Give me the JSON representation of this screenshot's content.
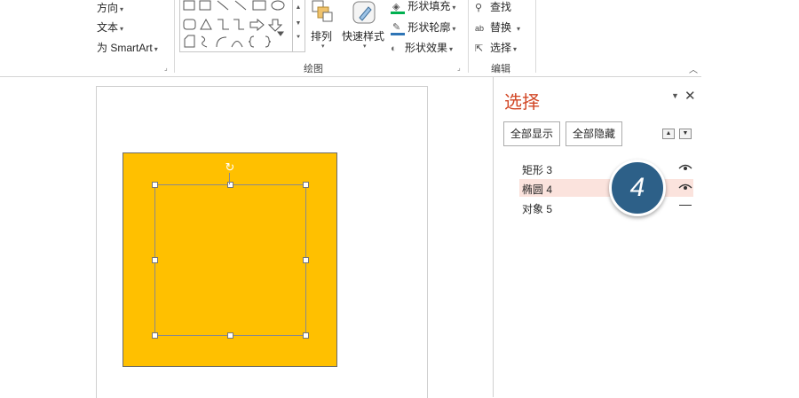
{
  "ribbon": {
    "text_group": {
      "direction_label": "方向",
      "text_label": "文本",
      "smartart_label": "为 SmartArt"
    },
    "drawing_group": {
      "label": "绘图",
      "arrange_label": "排列",
      "quick_styles_label": "快速样式",
      "shape_fill_label": "形状填充",
      "shape_outline_label": "形状轮廓",
      "shape_effects_label": "形状效果"
    },
    "editing_group": {
      "label": "编辑",
      "find_label": "查找",
      "replace_label": "替换",
      "select_label": "选择"
    },
    "colors": {
      "fill_swatch": "#00b050",
      "outline_swatch": "#2e75b6"
    }
  },
  "canvas": {
    "rect_fill": "#ffc000"
  },
  "selection_pane": {
    "title": "选择",
    "show_all_label": "全部显示",
    "hide_all_label": "全部隐藏",
    "items": [
      {
        "label": "矩形 3",
        "visible": true,
        "selected": false
      },
      {
        "label": "椭圆 4",
        "visible": true,
        "selected": true
      },
      {
        "label": "对象 5",
        "visible": false,
        "selected": false
      }
    ],
    "accent_color": "#d24726",
    "selected_row_color": "#fbe3dd"
  },
  "step_badge": {
    "number": "4",
    "color": "#2d6088"
  }
}
